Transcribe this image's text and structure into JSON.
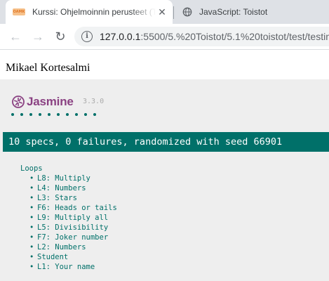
{
  "browser": {
    "tabs": [
      {
        "title": "Kurssi: Ohjelmoinnin perusteet (T",
        "favicon": "mooc-icon",
        "favicon_text": "OAMK",
        "active": true,
        "close": "✕"
      },
      {
        "title": "JavaScript: Toistot",
        "favicon": "globe-icon",
        "active": false
      }
    ],
    "toolbar": {
      "back": "←",
      "forward": "→",
      "reload": "↻",
      "info": "i",
      "url_host": "127.0.0.1",
      "url_rest": ":5500/5.%20Toistot/5.1%20toistot/test/testin"
    }
  },
  "page": {
    "author": "Mikael Kortesalmi"
  },
  "jasmine": {
    "name": "Jasmine",
    "version": "3.3.0",
    "dot_count": 10,
    "summary": "10 specs, 0 failures, randomized with seed 66901",
    "colors": {
      "brand": "#8a4182",
      "pass": "#007069",
      "background": "#eeeeee"
    },
    "suite": {
      "title": "Loops",
      "bullet": "•",
      "specs": [
        "L8: Multiply",
        "L4: Numbers",
        "L3: Stars",
        "F6: Heads or tails",
        "L9: Multiply all",
        "L5: Divisibility",
        "F7: Joker number",
        "L2: Numbers",
        "Student",
        "L1: Your name"
      ]
    }
  }
}
